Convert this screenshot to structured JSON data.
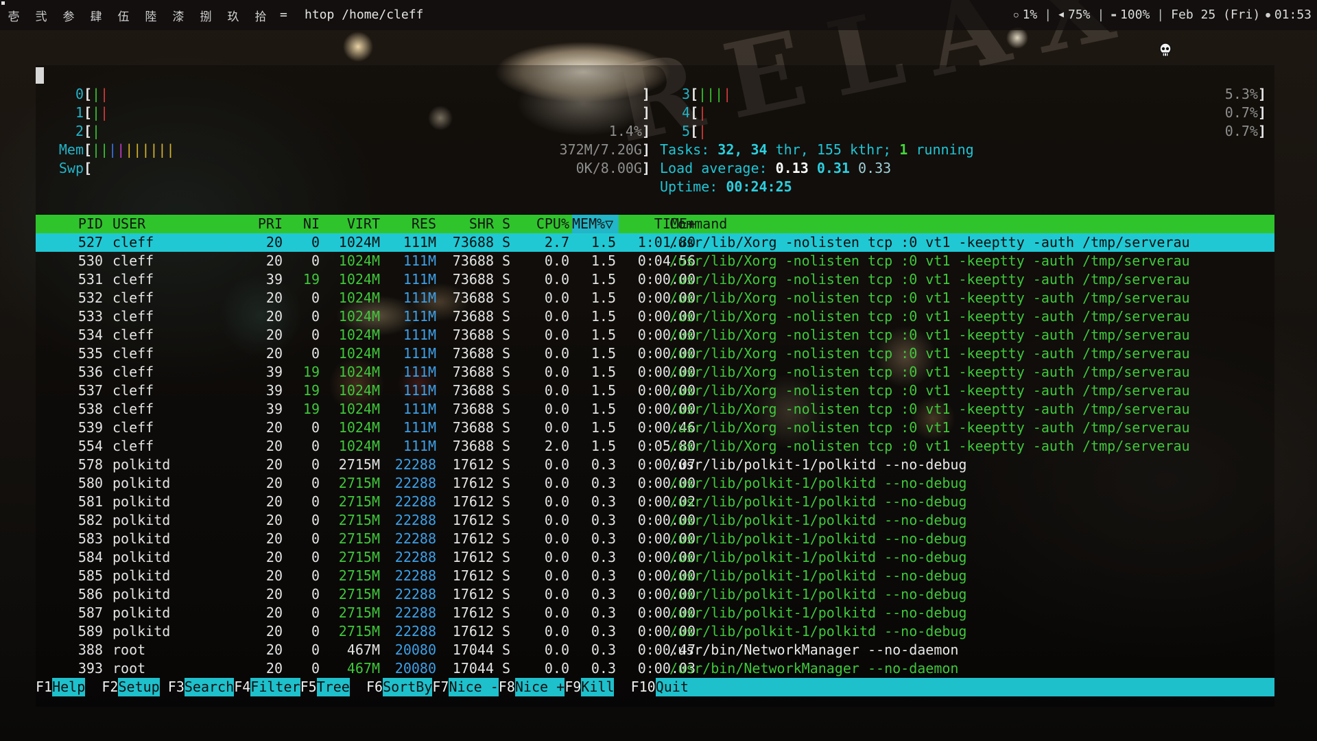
{
  "topbar": {
    "workspaces": [
      "壱",
      "弐",
      "参",
      "肆",
      "伍",
      "陸",
      "漆",
      "捌",
      "玖",
      "拾"
    ],
    "layout_symbol": "=",
    "window_title": "htop /home/cleff",
    "cpu_glyph": "○",
    "cpu_percent": "1%",
    "volume_glyph": "◀",
    "volume": "75%",
    "battery_glyph": "▬",
    "battery": "100%",
    "date": "Feb 25 (Fri)",
    "clock_glyph": "●",
    "time": "01:53",
    "separator": "|"
  },
  "meters": {
    "cpus": [
      {
        "label": "0",
        "bars": [
          {
            "c": "g",
            "t": "|"
          },
          {
            "c": "r",
            "t": "|"
          }
        ],
        "value": ""
      },
      {
        "label": "1",
        "bars": [
          {
            "c": "g",
            "t": "|"
          },
          {
            "c": "r",
            "t": "|"
          }
        ],
        "value": ""
      },
      {
        "label": "2",
        "bars": [
          {
            "c": "g",
            "t": "|"
          }
        ],
        "value": "1.4%"
      },
      {
        "label": "3",
        "bars": [
          {
            "c": "g",
            "t": "|||"
          },
          {
            "c": "r",
            "t": "|"
          }
        ],
        "value": "5.3%"
      },
      {
        "label": "4",
        "bars": [
          {
            "c": "r",
            "t": "|"
          }
        ],
        "value": "0.7%"
      },
      {
        "label": "5",
        "bars": [
          {
            "c": "r",
            "t": "|"
          }
        ],
        "value": "0.7%"
      }
    ],
    "mem": {
      "label": "Mem",
      "value": "372M/7.20G"
    },
    "swp": {
      "label": "Swp",
      "value": "0K/8.00G"
    },
    "open_bracket": "[",
    "close_bracket": "]",
    "tasks": {
      "label": "Tasks:",
      "procs": "32,",
      "threads": "34",
      "thr_label": "thr,",
      "kthreads": "155",
      "kthr_label": "kthr;",
      "running": "1",
      "running_label": "running"
    },
    "load": {
      "label": "Load average:",
      "one": "0.13",
      "five": "0.31",
      "fifteen": "0.33"
    },
    "uptime": {
      "label": "Uptime:",
      "value": "00:24:25"
    }
  },
  "table": {
    "columns": [
      "PID",
      "USER",
      "PRI",
      "NI",
      "VIRT",
      "RES",
      "SHR",
      "S",
      "CPU%",
      "MEM%▽",
      "TIME+",
      "Command"
    ],
    "rows": [
      {
        "pid": "527",
        "user": "cleff",
        "pri": "20",
        "ni": "0",
        "virt": "1024M",
        "res": "111M",
        "shr": "73688",
        "s": "S",
        "cpu": "2.7",
        "mem": "1.5",
        "time": "1:01.80",
        "cmd": "/usr/lib/Xorg -nolisten tcp :0 vt1 -keeptty -auth /tmp/serverau",
        "selected": true,
        "thread": false
      },
      {
        "pid": "530",
        "user": "cleff",
        "pri": "20",
        "ni": "0",
        "virt": "1024M",
        "res": "111M",
        "shr": "73688",
        "s": "S",
        "cpu": "0.0",
        "mem": "1.5",
        "time": "0:04.56",
        "cmd": "/usr/lib/Xorg -nolisten tcp :0 vt1 -keeptty -auth /tmp/serverau",
        "selected": false,
        "thread": true
      },
      {
        "pid": "531",
        "user": "cleff",
        "pri": "39",
        "ni": "19",
        "virt": "1024M",
        "res": "111M",
        "shr": "73688",
        "s": "S",
        "cpu": "0.0",
        "mem": "1.5",
        "time": "0:00.00",
        "cmd": "/usr/lib/Xorg -nolisten tcp :0 vt1 -keeptty -auth /tmp/serverau",
        "selected": false,
        "thread": true
      },
      {
        "pid": "532",
        "user": "cleff",
        "pri": "20",
        "ni": "0",
        "virt": "1024M",
        "res": "111M",
        "shr": "73688",
        "s": "S",
        "cpu": "0.0",
        "mem": "1.5",
        "time": "0:00.00",
        "cmd": "/usr/lib/Xorg -nolisten tcp :0 vt1 -keeptty -auth /tmp/serverau",
        "selected": false,
        "thread": true
      },
      {
        "pid": "533",
        "user": "cleff",
        "pri": "20",
        "ni": "0",
        "virt": "1024M",
        "res": "111M",
        "shr": "73688",
        "s": "S",
        "cpu": "0.0",
        "mem": "1.5",
        "time": "0:00.00",
        "cmd": "/usr/lib/Xorg -nolisten tcp :0 vt1 -keeptty -auth /tmp/serverau",
        "selected": false,
        "thread": true
      },
      {
        "pid": "534",
        "user": "cleff",
        "pri": "20",
        "ni": "0",
        "virt": "1024M",
        "res": "111M",
        "shr": "73688",
        "s": "S",
        "cpu": "0.0",
        "mem": "1.5",
        "time": "0:00.00",
        "cmd": "/usr/lib/Xorg -nolisten tcp :0 vt1 -keeptty -auth /tmp/serverau",
        "selected": false,
        "thread": true
      },
      {
        "pid": "535",
        "user": "cleff",
        "pri": "20",
        "ni": "0",
        "virt": "1024M",
        "res": "111M",
        "shr": "73688",
        "s": "S",
        "cpu": "0.0",
        "mem": "1.5",
        "time": "0:00.00",
        "cmd": "/usr/lib/Xorg -nolisten tcp :0 vt1 -keeptty -auth /tmp/serverau",
        "selected": false,
        "thread": true
      },
      {
        "pid": "536",
        "user": "cleff",
        "pri": "39",
        "ni": "19",
        "virt": "1024M",
        "res": "111M",
        "shr": "73688",
        "s": "S",
        "cpu": "0.0",
        "mem": "1.5",
        "time": "0:00.00",
        "cmd": "/usr/lib/Xorg -nolisten tcp :0 vt1 -keeptty -auth /tmp/serverau",
        "selected": false,
        "thread": true
      },
      {
        "pid": "537",
        "user": "cleff",
        "pri": "39",
        "ni": "19",
        "virt": "1024M",
        "res": "111M",
        "shr": "73688",
        "s": "S",
        "cpu": "0.0",
        "mem": "1.5",
        "time": "0:00.00",
        "cmd": "/usr/lib/Xorg -nolisten tcp :0 vt1 -keeptty -auth /tmp/serverau",
        "selected": false,
        "thread": true
      },
      {
        "pid": "538",
        "user": "cleff",
        "pri": "39",
        "ni": "19",
        "virt": "1024M",
        "res": "111M",
        "shr": "73688",
        "s": "S",
        "cpu": "0.0",
        "mem": "1.5",
        "time": "0:00.00",
        "cmd": "/usr/lib/Xorg -nolisten tcp :0 vt1 -keeptty -auth /tmp/serverau",
        "selected": false,
        "thread": true
      },
      {
        "pid": "539",
        "user": "cleff",
        "pri": "20",
        "ni": "0",
        "virt": "1024M",
        "res": "111M",
        "shr": "73688",
        "s": "S",
        "cpu": "0.0",
        "mem": "1.5",
        "time": "0:00.46",
        "cmd": "/usr/lib/Xorg -nolisten tcp :0 vt1 -keeptty -auth /tmp/serverau",
        "selected": false,
        "thread": true
      },
      {
        "pid": "554",
        "user": "cleff",
        "pri": "20",
        "ni": "0",
        "virt": "1024M",
        "res": "111M",
        "shr": "73688",
        "s": "S",
        "cpu": "2.0",
        "mem": "1.5",
        "time": "0:05.80",
        "cmd": "/usr/lib/Xorg -nolisten tcp :0 vt1 -keeptty -auth /tmp/serverau",
        "selected": false,
        "thread": true
      },
      {
        "pid": "578",
        "user": "polkitd",
        "pri": "20",
        "ni": "0",
        "virt": "2715M",
        "res": "22288",
        "shr": "17612",
        "s": "S",
        "cpu": "0.0",
        "mem": "0.3",
        "time": "0:00.07",
        "cmd": "/usr/lib/polkit-1/polkitd --no-debug",
        "selected": false,
        "thread": false
      },
      {
        "pid": "580",
        "user": "polkitd",
        "pri": "20",
        "ni": "0",
        "virt": "2715M",
        "res": "22288",
        "shr": "17612",
        "s": "S",
        "cpu": "0.0",
        "mem": "0.3",
        "time": "0:00.00",
        "cmd": "/usr/lib/polkit-1/polkitd --no-debug",
        "selected": false,
        "thread": true
      },
      {
        "pid": "581",
        "user": "polkitd",
        "pri": "20",
        "ni": "0",
        "virt": "2715M",
        "res": "22288",
        "shr": "17612",
        "s": "S",
        "cpu": "0.0",
        "mem": "0.3",
        "time": "0:00.02",
        "cmd": "/usr/lib/polkit-1/polkitd --no-debug",
        "selected": false,
        "thread": true
      },
      {
        "pid": "582",
        "user": "polkitd",
        "pri": "20",
        "ni": "0",
        "virt": "2715M",
        "res": "22288",
        "shr": "17612",
        "s": "S",
        "cpu": "0.0",
        "mem": "0.3",
        "time": "0:00.00",
        "cmd": "/usr/lib/polkit-1/polkitd --no-debug",
        "selected": false,
        "thread": true
      },
      {
        "pid": "583",
        "user": "polkitd",
        "pri": "20",
        "ni": "0",
        "virt": "2715M",
        "res": "22288",
        "shr": "17612",
        "s": "S",
        "cpu": "0.0",
        "mem": "0.3",
        "time": "0:00.00",
        "cmd": "/usr/lib/polkit-1/polkitd --no-debug",
        "selected": false,
        "thread": true
      },
      {
        "pid": "584",
        "user": "polkitd",
        "pri": "20",
        "ni": "0",
        "virt": "2715M",
        "res": "22288",
        "shr": "17612",
        "s": "S",
        "cpu": "0.0",
        "mem": "0.3",
        "time": "0:00.00",
        "cmd": "/usr/lib/polkit-1/polkitd --no-debug",
        "selected": false,
        "thread": true
      },
      {
        "pid": "585",
        "user": "polkitd",
        "pri": "20",
        "ni": "0",
        "virt": "2715M",
        "res": "22288",
        "shr": "17612",
        "s": "S",
        "cpu": "0.0",
        "mem": "0.3",
        "time": "0:00.00",
        "cmd": "/usr/lib/polkit-1/polkitd --no-debug",
        "selected": false,
        "thread": true
      },
      {
        "pid": "586",
        "user": "polkitd",
        "pri": "20",
        "ni": "0",
        "virt": "2715M",
        "res": "22288",
        "shr": "17612",
        "s": "S",
        "cpu": "0.0",
        "mem": "0.3",
        "time": "0:00.00",
        "cmd": "/usr/lib/polkit-1/polkitd --no-debug",
        "selected": false,
        "thread": true
      },
      {
        "pid": "587",
        "user": "polkitd",
        "pri": "20",
        "ni": "0",
        "virt": "2715M",
        "res": "22288",
        "shr": "17612",
        "s": "S",
        "cpu": "0.0",
        "mem": "0.3",
        "time": "0:00.00",
        "cmd": "/usr/lib/polkit-1/polkitd --no-debug",
        "selected": false,
        "thread": true
      },
      {
        "pid": "589",
        "user": "polkitd",
        "pri": "20",
        "ni": "0",
        "virt": "2715M",
        "res": "22288",
        "shr": "17612",
        "s": "S",
        "cpu": "0.0",
        "mem": "0.3",
        "time": "0:00.00",
        "cmd": "/usr/lib/polkit-1/polkitd --no-debug",
        "selected": false,
        "thread": true
      },
      {
        "pid": "388",
        "user": "root",
        "pri": "20",
        "ni": "0",
        "virt": "467M",
        "res": "20080",
        "shr": "17044",
        "s": "S",
        "cpu": "0.0",
        "mem": "0.3",
        "time": "0:00.47",
        "cmd": "/usr/bin/NetworkManager --no-daemon",
        "selected": false,
        "thread": false
      },
      {
        "pid": "393",
        "user": "root",
        "pri": "20",
        "ni": "0",
        "virt": "467M",
        "res": "20080",
        "shr": "17044",
        "s": "S",
        "cpu": "0.0",
        "mem": "0.3",
        "time": "0:00.03",
        "cmd": "/usr/bin/NetworkManager --no-daemon",
        "selected": false,
        "thread": true
      }
    ]
  },
  "fkeys": [
    {
      "key": "F1",
      "label": "Help  "
    },
    {
      "key": "F2",
      "label": "Setup "
    },
    {
      "key": "F3",
      "label": "Search"
    },
    {
      "key": "F4",
      "label": "Filter"
    },
    {
      "key": "F5",
      "label": "Tree  "
    },
    {
      "key": "F6",
      "label": "SortBy"
    },
    {
      "key": "F7",
      "label": "Nice -"
    },
    {
      "key": "F8",
      "label": "Nice +"
    },
    {
      "key": "F9",
      "label": "Kill  "
    },
    {
      "key": "F10",
      "label": "Quit"
    }
  ],
  "colors": {
    "header_green": "#2fc42c",
    "selection_cyan": "#20c8d4",
    "thread_green": "#3fc83a",
    "res_blue": "#3da0e8",
    "label_cyan": "#22b4c8"
  },
  "icons": {
    "mouse_cursor": "skull-cursor-icon"
  }
}
